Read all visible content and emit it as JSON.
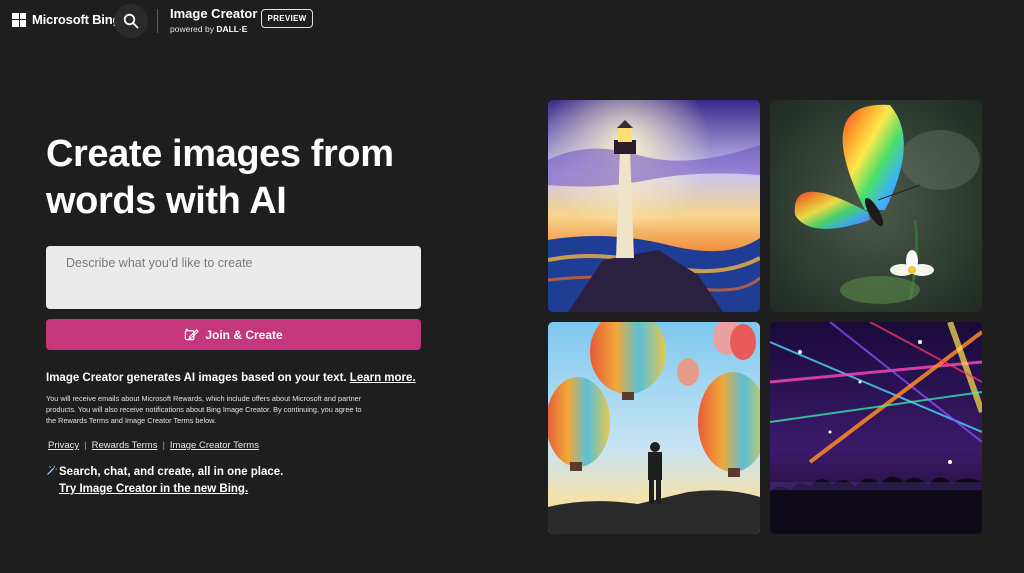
{
  "header": {
    "brand": "Microsoft Bing",
    "product_title": "Image Creator",
    "product_sub_prefix": "powered by ",
    "product_sub_brand": "DALL·E",
    "preview_badge": "PREVIEW"
  },
  "hero": {
    "title_line1": "Create images from",
    "title_line2": "words with AI"
  },
  "prompt": {
    "placeholder": "Describe what you'd like to create",
    "value": ""
  },
  "join_button": {
    "label": "Join & Create",
    "color": "#c5377c"
  },
  "info": {
    "text": "Image Creator generates AI images based on your text.",
    "learn_more": "Learn more."
  },
  "fine_print": "You will receive emails about Microsoft Rewards, which include offers about Microsoft and partner products. You will also receive notifications about Bing Image Creator. By continuing, you agree to the Rewards Terms and Image Creator Terms below.",
  "footer_links": [
    "Privacy",
    "Rewards Terms",
    "Image Creator Terms"
  ],
  "promo": {
    "line1": "Search, chat, and create, all in one place.",
    "line2": "Try Image Creator in the new Bing."
  },
  "gallery": [
    {
      "subject": "lighthouse-sunset"
    },
    {
      "subject": "rainbow-butterfly"
    },
    {
      "subject": "hot-air-balloons"
    },
    {
      "subject": "concert-lasers"
    }
  ],
  "colors": {
    "background": "#1f1e1e",
    "accent": "#c5377c",
    "input_bg": "#ebebeb"
  }
}
